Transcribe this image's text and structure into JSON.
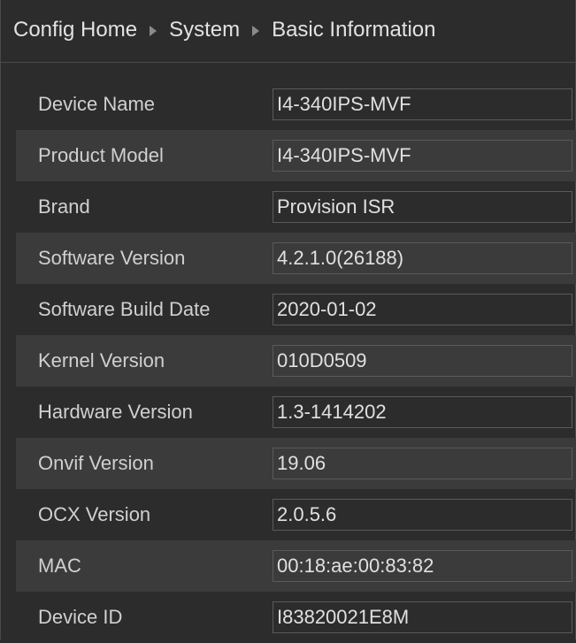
{
  "breadcrumb": {
    "items": [
      "Config Home",
      "System",
      "Basic Information"
    ]
  },
  "form": {
    "fields": [
      {
        "label": "Device Name",
        "value": "I4-340IPS-MVF"
      },
      {
        "label": "Product Model",
        "value": "I4-340IPS-MVF"
      },
      {
        "label": "Brand",
        "value": "Provision ISR"
      },
      {
        "label": "Software Version",
        "value": "4.2.1.0(26188)"
      },
      {
        "label": "Software Build Date",
        "value": "2020-01-02"
      },
      {
        "label": "Kernel Version",
        "value": "010D0509"
      },
      {
        "label": "Hardware Version",
        "value": "1.3-1414202"
      },
      {
        "label": "Onvif Version",
        "value": "19.06"
      },
      {
        "label": "OCX Version",
        "value": "2.0.5.6"
      },
      {
        "label": "MAC",
        "value": "00:18:ae:00:83:82"
      },
      {
        "label": "Device ID",
        "value": "I83820021E8M"
      }
    ]
  },
  "colors": {
    "background": "#2c2c2c",
    "alt_row": "#3b3b3b",
    "border": "#5a5a5a",
    "text": "#d4d4d4"
  }
}
